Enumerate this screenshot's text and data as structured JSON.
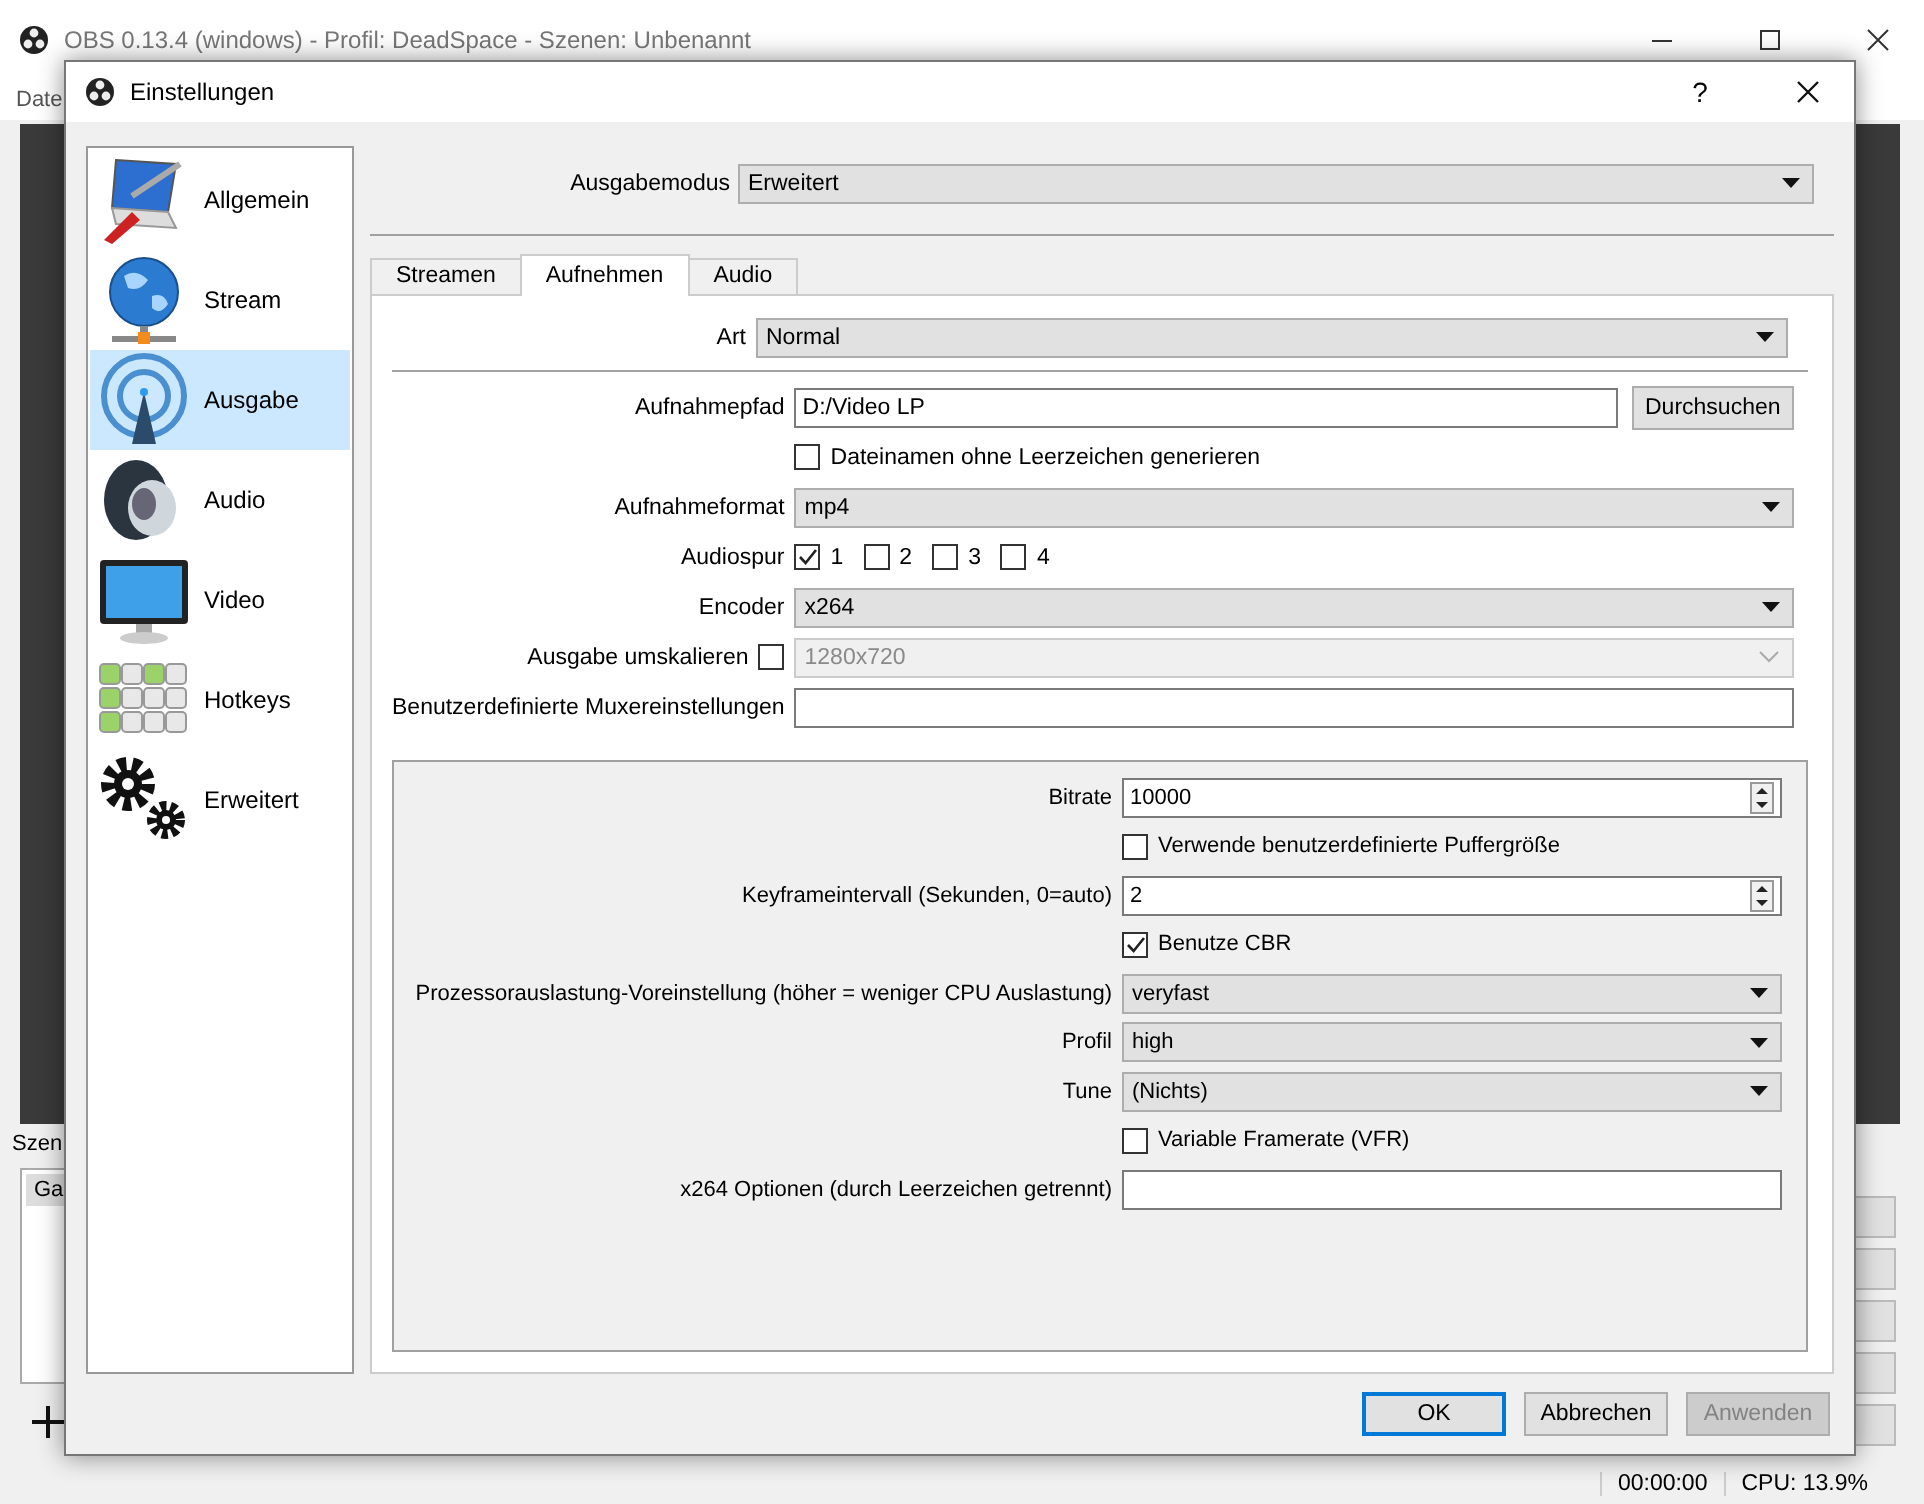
{
  "main_window": {
    "title": "OBS 0.13.4 (windows) - Profil: DeadSpace - Szenen: Unbenannt",
    "menu": [
      "Date"
    ],
    "scenes_label": "Szen",
    "scenes": [
      {
        "label": "Ga",
        "selected": true
      }
    ],
    "status_bar": [
      "00:00:00",
      "CPU: 13.9%"
    ]
  },
  "dialog": {
    "title": "Einstellungen",
    "help": "?"
  },
  "sidebar": [
    {
      "kind": "general",
      "label": "Allgemein",
      "selected": false
    },
    {
      "kind": "stream",
      "label": "Stream",
      "selected": false
    },
    {
      "kind": "output",
      "label": "Ausgabe",
      "selected": true
    },
    {
      "kind": "audio",
      "label": "Audio",
      "selected": false
    },
    {
      "kind": "video",
      "label": "Video",
      "selected": false
    },
    {
      "kind": "hotkeys",
      "label": "Hotkeys",
      "selected": false
    },
    {
      "kind": "advanced",
      "label": "Erweitert",
      "selected": false
    }
  ],
  "output_mode": {
    "label": "Ausgabemodus",
    "value": "Erweitert"
  },
  "tabs": [
    {
      "label": "Streamen",
      "selected": false
    },
    {
      "label": "Aufnehmen",
      "selected": true
    },
    {
      "label": "Audio",
      "selected": false
    }
  ],
  "recording_type": {
    "label": "Art",
    "value": "Normal"
  },
  "recording": [
    {
      "kind": "path",
      "label": "Aufnahmepfad",
      "value": "D:/Video LP",
      "button": "Durchsuchen"
    },
    {
      "kind": "checkbox",
      "text": "Dateinamen ohne Leerzeichen generieren",
      "checked": false
    },
    {
      "kind": "combo",
      "label": "Aufnahmeformat",
      "value": "mp4"
    },
    {
      "kind": "tracks",
      "label": "Audiospur",
      "tracks": [
        {
          "text": "1",
          "checked": true
        },
        {
          "text": "2",
          "checked": false
        },
        {
          "text": "3",
          "checked": false
        },
        {
          "text": "4",
          "checked": false
        }
      ]
    },
    {
      "kind": "combo",
      "label": "Encoder",
      "value": "x264"
    },
    {
      "kind": "rescale",
      "label": "Ausgabe umskalieren",
      "checked": false,
      "value": "1280x720",
      "disabled": true
    },
    {
      "kind": "text",
      "label": "Benutzerdefinierte Muxereinstellungen"
    }
  ],
  "encoder_settings": [
    {
      "kind": "spin",
      "label": "Bitrate",
      "value": "10000"
    },
    {
      "kind": "checkbox",
      "text": "Verwende benutzerdefinierte Puffergröße",
      "checked": false
    },
    {
      "kind": "spin",
      "label": "Keyframeintervall (Sekunden, 0=auto)",
      "value": "2"
    },
    {
      "kind": "checkbox",
      "text": "Benutze CBR",
      "checked": true
    },
    {
      "kind": "combo",
      "label": "Prozessorauslastung-Voreinstellung (höher = weniger CPU Auslastung)",
      "value": "veryfast"
    },
    {
      "kind": "combo",
      "label": "Profil",
      "value": "high"
    },
    {
      "kind": "combo",
      "label": "Tune",
      "value": "(Nichts)"
    },
    {
      "kind": "checkbox",
      "text": "Variable Framerate (VFR)",
      "checked": false
    },
    {
      "kind": "text",
      "label": "x264 Optionen (durch Leerzeichen getrennt)"
    }
  ],
  "buttons": [
    {
      "label": "OK",
      "default": true,
      "disabled": false
    },
    {
      "label": "Abbrechen",
      "default": false,
      "disabled": false
    },
    {
      "label": "Anwenden",
      "default": false,
      "disabled": true
    }
  ]
}
